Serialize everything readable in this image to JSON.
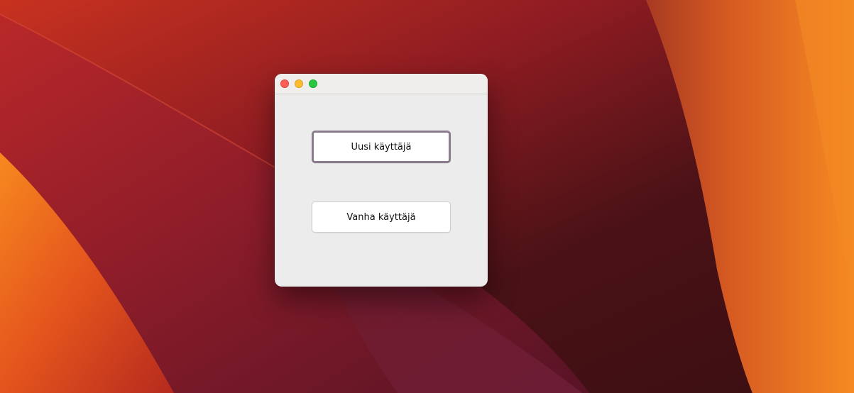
{
  "window": {
    "buttons": {
      "new_user": "Uusi käyttäjä",
      "old_user": "Vanha käyttäjä"
    }
  },
  "colors": {
    "close": "#ff5f57",
    "minimize": "#febc2e",
    "zoom": "#28c840",
    "focus_ring": "#8a7c8c",
    "window_bg": "#ececec"
  }
}
